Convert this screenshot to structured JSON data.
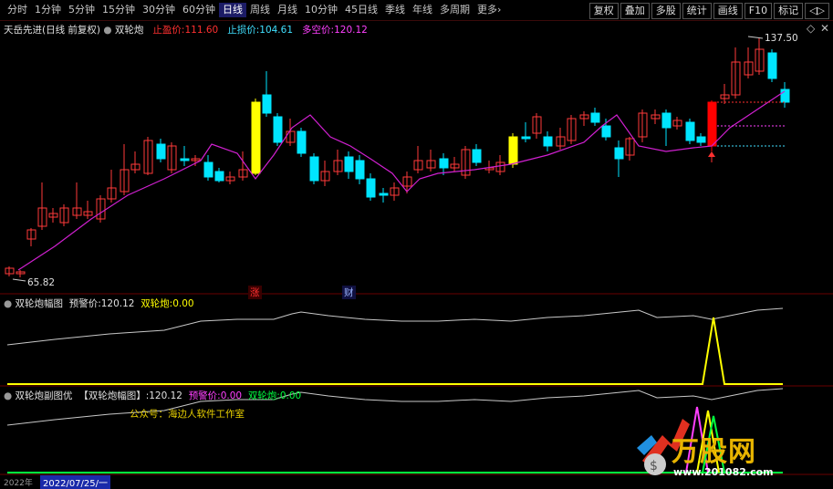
{
  "toolbar": {
    "periods": [
      "分时",
      "1分钟",
      "5分钟",
      "15分钟",
      "30分钟",
      "60分钟",
      "日线",
      "周线",
      "月线",
      "10分钟",
      "45日线",
      "季线",
      "年线",
      "多周期",
      "更多›"
    ],
    "active_period": "日线",
    "right_buttons": [
      "复权",
      "叠加",
      "多股",
      "统计",
      "画线",
      "F10",
      "标记",
      "◁▷"
    ]
  },
  "main_panel": {
    "stock_title": "天岳先进(日线 前复权)",
    "indicator_name": "双轮炮",
    "stop_profit_label": "止盈价:",
    "stop_profit_value": "111.60",
    "stop_loss_label": "止损价:",
    "stop_loss_value": "104.61",
    "target_label": "多空价:",
    "target_value": "120.12",
    "high_price_label": "137.50",
    "low_price_label": "65.82",
    "marker_zhang": "涨",
    "marker_cai": "财"
  },
  "panel2": {
    "name": "双轮炮幅图",
    "warn_label": "预警价:",
    "warn_value": "120.12",
    "signal_label": "双轮炮:",
    "signal_value": "0.00"
  },
  "panel3": {
    "name": "双轮炮副图优",
    "bracket_label": "【双轮炮幅图】:",
    "bracket_value": "120.12",
    "warn_label": "预警价:",
    "warn_value": "0.00",
    "signal_label": "双轮炮:",
    "signal_value": "0.00",
    "wechat_text": "公众号：海边人软件工作室"
  },
  "date_axis": {
    "left_label": "2022年",
    "cursor_date": "2022/07/25/一"
  },
  "watermark": {
    "title": "万股网",
    "url": "www.201082.com"
  },
  "colors": {
    "up": "#ff3a3a",
    "down": "#00e5ff",
    "signal": "#ffff00",
    "ma": "#d020d0",
    "line": "#c8c8c8"
  }
}
